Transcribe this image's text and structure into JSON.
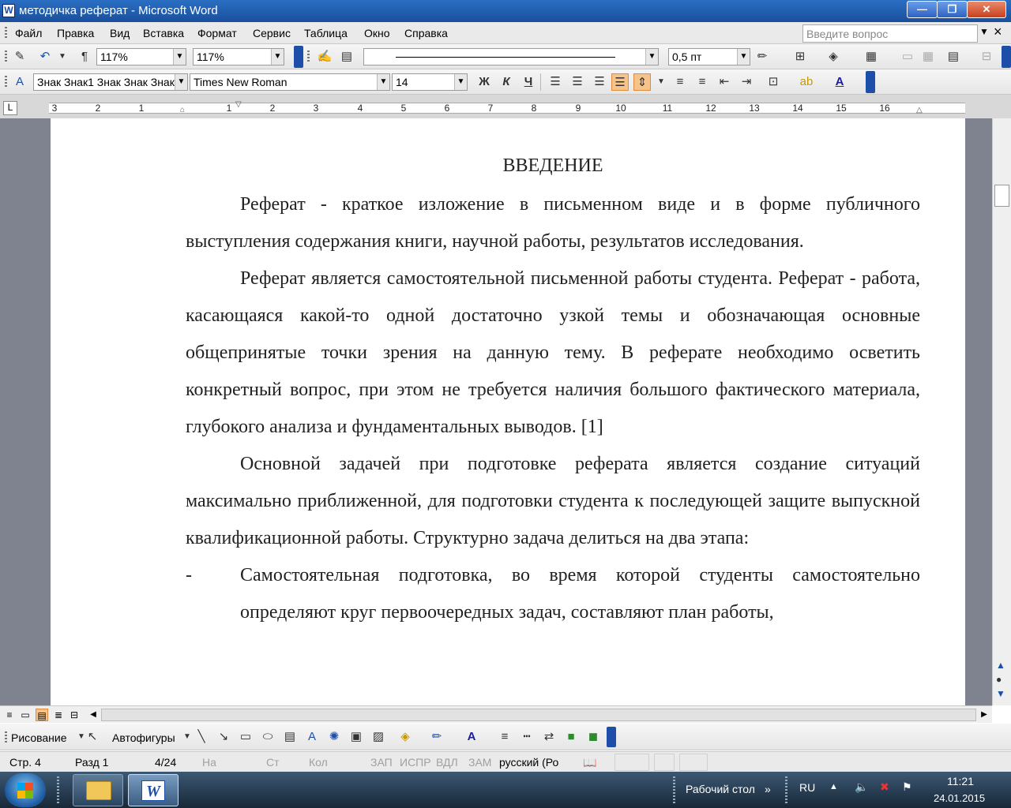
{
  "window": {
    "title": "методичка реферат - Microsoft Word",
    "app_icon": "W",
    "min": "—",
    "max": "❐",
    "close": "✕"
  },
  "menu": {
    "items": [
      "Файл",
      "Правка",
      "Вид",
      "Вставка",
      "Формат",
      "Сервис",
      "Таблица",
      "Окно",
      "Справка"
    ],
    "ask_placeholder": "Введите вопрос"
  },
  "toolbar1": {
    "zoom1": "117%",
    "zoom2": "117%",
    "line_weight": "0,5 пт"
  },
  "toolbar2": {
    "style": "Знак Знак1 Знак Знак Знак",
    "font": "Times New Roman",
    "size": "14",
    "bold": "Ж",
    "italic": "К",
    "underline": "Ч"
  },
  "ruler": {
    "numbers": [
      "3",
      "2",
      "1",
      "1",
      "2",
      "3",
      "4",
      "5",
      "6",
      "7",
      "8",
      "9",
      "10",
      "11",
      "12",
      "13",
      "14",
      "15",
      "16"
    ],
    "tab_symbol": "L"
  },
  "document": {
    "heading": "ВВЕДЕНИЕ",
    "paragraphs": [
      "Реферат - краткое изложение в письменном виде и в форме публичного выступления содержания книги, научной работы, результатов исследования.",
      "Реферат является самостоятельной письменной работы студента. Реферат - работа, касающаяся какой-то одной достаточно узкой темы и обозначающая основные общепринятые точки зрения на данную тему. В реферате необходимо осветить конкретный вопрос, при этом не требуется наличия большого фактического материала, глубокого анализа и фундаментальных выводов. [1]",
      "Основной задачей при подготовке реферата является создание ситуаций максимально приближенной, для подготовки студента к последующей защите выпускной квалификационной работы. Структурно задача делиться на два этапа:"
    ],
    "list_item": {
      "marker": "-",
      "text": "Самостоятельная подготовка, во время которой студенты самостоятельно определяют круг первоочередных задач, составляют план работы,"
    }
  },
  "drawing": {
    "draw_label": "Рисование",
    "autoshapes_label": "Автофигуры"
  },
  "status": {
    "page": "Стр. 4",
    "section": "Разд 1",
    "pages": "4/24",
    "at": "На",
    "line": "Ст",
    "col": "Кол",
    "rec": "ЗАП",
    "trk": "ИСПР",
    "ext": "ВДЛ",
    "ovr": "ЗАМ",
    "lang": "русский (Ро"
  },
  "taskbar": {
    "desktop": "Рабочий стол",
    "lang": "RU",
    "time": "11:21",
    "date": "24.01.2015"
  }
}
